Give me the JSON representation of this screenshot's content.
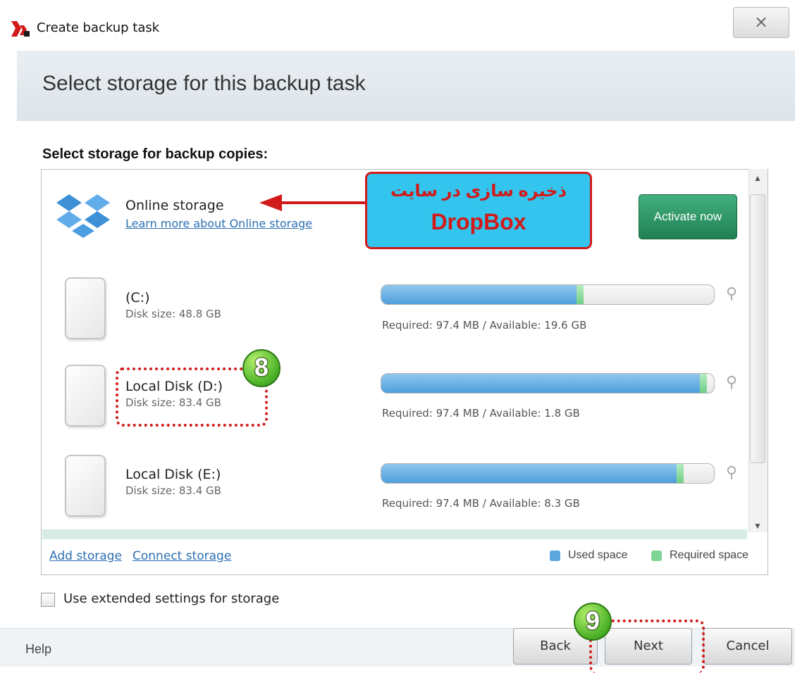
{
  "window": {
    "title": "Create backup task",
    "close_glyph": "×"
  },
  "header": {
    "title": "Select storage for this backup task"
  },
  "main": {
    "section_label": "Select storage for backup copies:"
  },
  "online_storage": {
    "label": "Online storage",
    "link": "Learn more about Online storage",
    "activate_label": "Activate now",
    "icon": "dropbox-icon"
  },
  "callout": {
    "line1": "ذخیره سازی در سایت",
    "line2": "DropBox"
  },
  "disks": [
    {
      "name": "(C:)",
      "size": "Disk size: 48.8 GB",
      "status": "Required: 97.4 MB / Available: 19.6 GB",
      "used_fraction": 0.59
    },
    {
      "name": "Local Disk (D:)",
      "size": "Disk size: 83.4 GB",
      "status": "Required: 97.4 MB / Available: 1.8 GB",
      "used_fraction": 0.96
    },
    {
      "name": "Local Disk (E:)",
      "size": "Disk size: 83.4 GB",
      "status": "Required: 97.4 MB / Available: 8.3 GB",
      "used_fraction": 0.89
    }
  ],
  "panel_links": {
    "add": "Add storage",
    "connect": "Connect storage"
  },
  "legend": {
    "used": "Used space",
    "required": "Required space",
    "used_color": "#5aa7df",
    "required_color": "#7fd694"
  },
  "annotations": {
    "step8": "8",
    "step9": "9",
    "accent_color": "#d11a1a"
  },
  "options": {
    "extended_label": "Use extended settings for storage",
    "extended_checked": false
  },
  "footer": {
    "help": "Help",
    "back": "Back",
    "next": "Next",
    "cancel": "Cancel"
  }
}
